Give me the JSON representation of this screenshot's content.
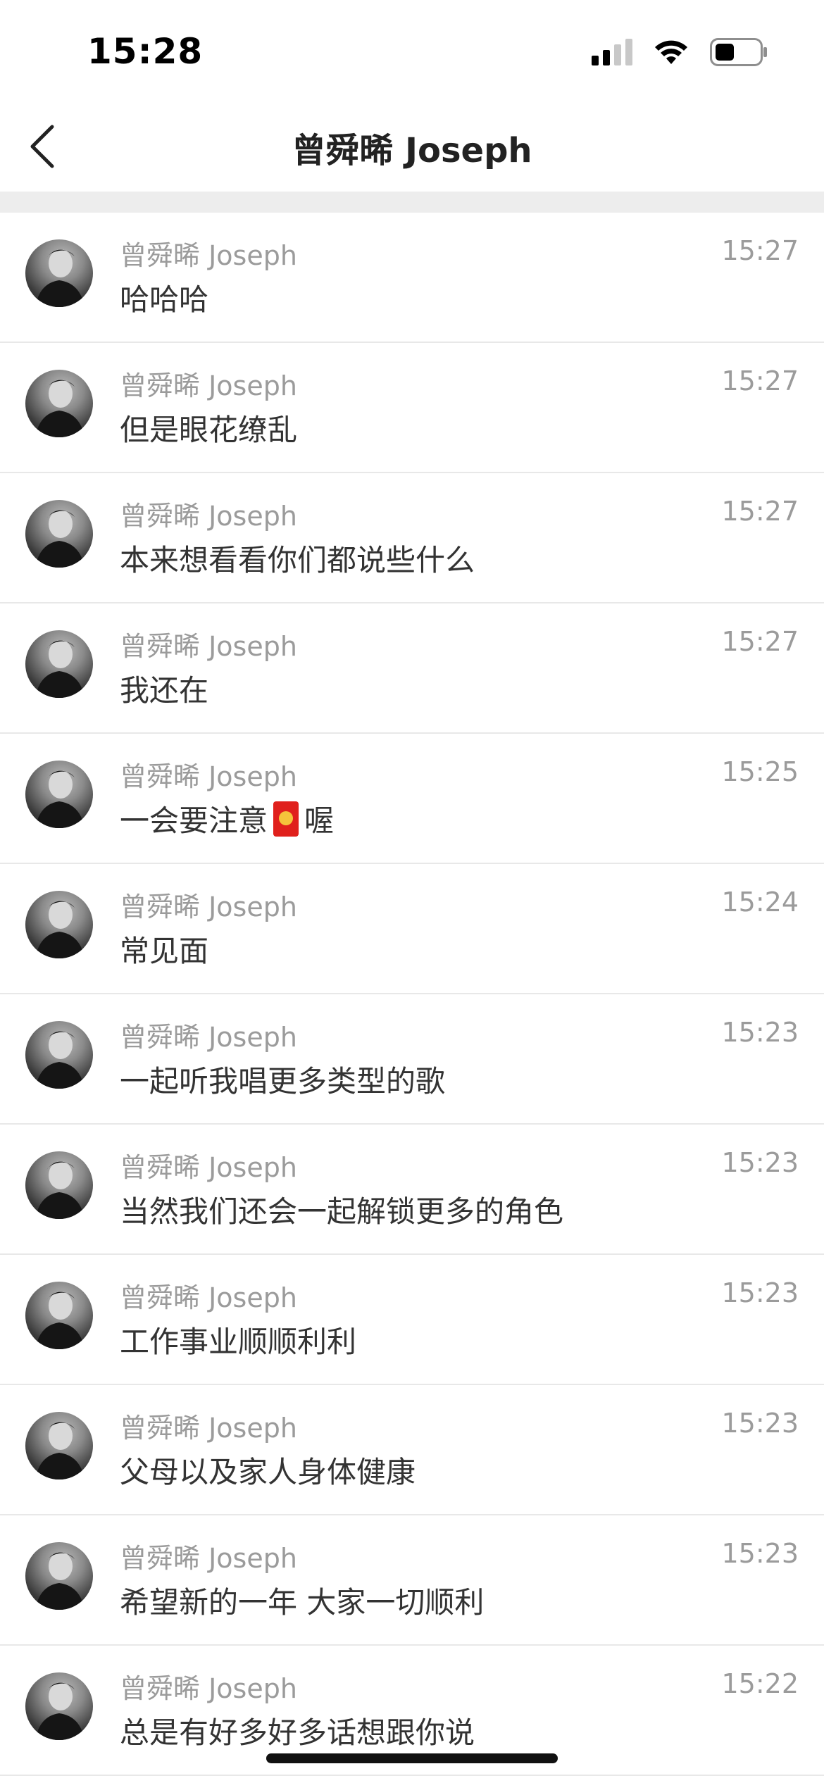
{
  "status_bar": {
    "time": "15:28"
  },
  "nav": {
    "title": "曾舜晞 Joseph"
  },
  "messages": [
    {
      "sender": "曾舜晞 Joseph",
      "text": "哈哈哈",
      "time": "15:27"
    },
    {
      "sender": "曾舜晞 Joseph",
      "text": "但是眼花缭乱",
      "time": "15:27"
    },
    {
      "sender": "曾舜晞 Joseph",
      "text": "本来想看看你们都说些什么",
      "time": "15:27"
    },
    {
      "sender": "曾舜晞 Joseph",
      "text": "我还在",
      "time": "15:27"
    },
    {
      "sender": "曾舜晞 Joseph",
      "text_before": "一会要注意",
      "icon": "red-envelope-icon",
      "text_after": "喔",
      "time": "15:25"
    },
    {
      "sender": "曾舜晞 Joseph",
      "text": "常见面",
      "time": "15:24"
    },
    {
      "sender": "曾舜晞 Joseph",
      "text": "一起听我唱更多类型的歌",
      "time": "15:23"
    },
    {
      "sender": "曾舜晞 Joseph",
      "text": "当然我们还会一起解锁更多的角色",
      "time": "15:23"
    },
    {
      "sender": "曾舜晞 Joseph",
      "text": "工作事业顺顺利利",
      "time": "15:23"
    },
    {
      "sender": "曾舜晞 Joseph",
      "text": "父母以及家人身体健康",
      "time": "15:23"
    },
    {
      "sender": "曾舜晞 Joseph",
      "text": "希望新的一年 大家一切顺利",
      "time": "15:23"
    },
    {
      "sender": "曾舜晞 Joseph",
      "text": "总是有好多好多话想跟你说",
      "time": "15:22"
    }
  ]
}
